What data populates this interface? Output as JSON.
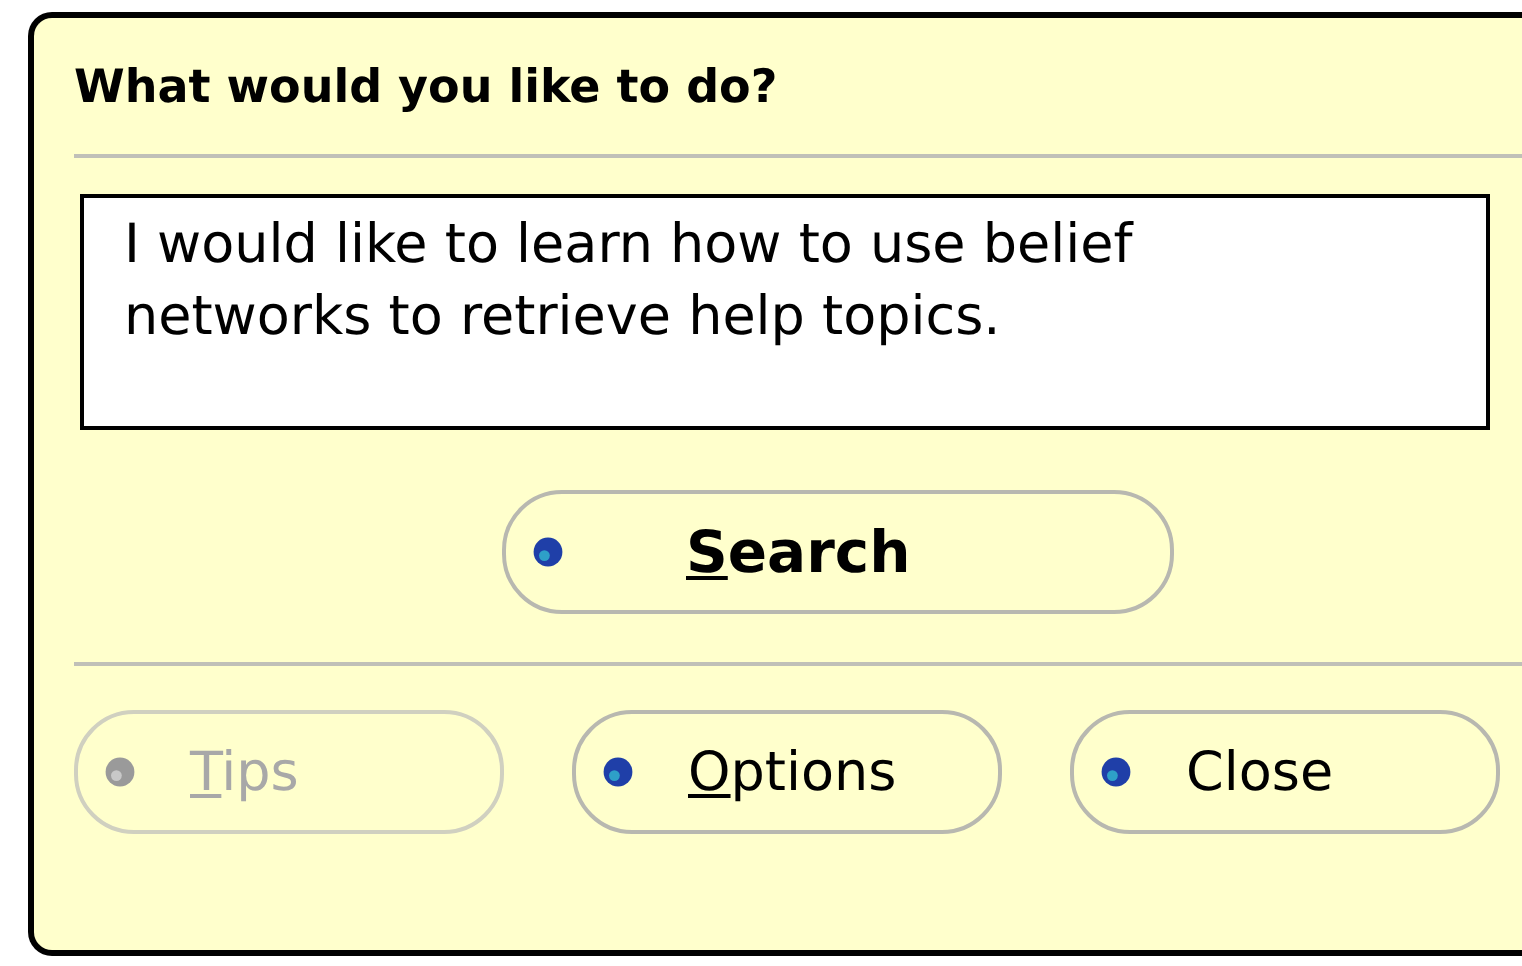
{
  "balloon": {
    "title": "What would you like to do?",
    "query": {
      "value": "I would like to learn how to use belief networks to retrieve help topics."
    },
    "search_button": {
      "label": "Search",
      "underline_first": true,
      "disabled": false
    },
    "buttons": [
      {
        "label": "Tips",
        "underline_first": true,
        "disabled": true
      },
      {
        "label": "Options",
        "underline_first": true,
        "disabled": false
      },
      {
        "label": "Close",
        "disabled": false
      }
    ]
  }
}
